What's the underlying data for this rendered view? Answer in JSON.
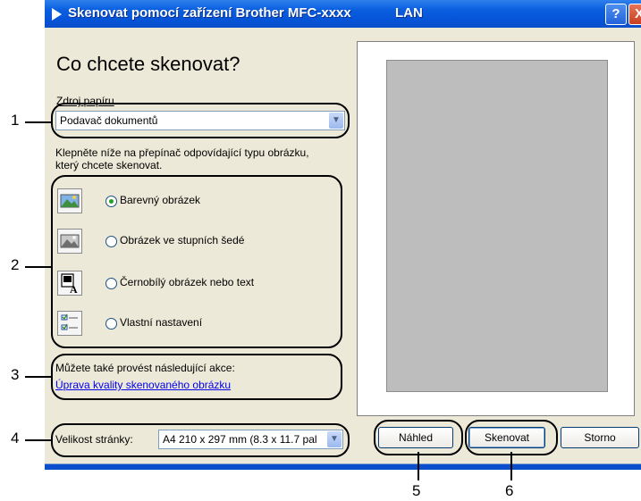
{
  "window": {
    "title": "Skenovat pomocí zařízení Brother MFC-xxxx",
    "title_suffix": "LAN",
    "help_label": "?",
    "close_label": "X"
  },
  "heading": "Co chcete skenovat?",
  "paper_source": {
    "label": "Zdroj papíru",
    "value": "Podavač dokumentů"
  },
  "instruction": {
    "line1": "Klepněte níže na přepínač odpovídající typu obrázku,",
    "line2": "který chcete skenovat."
  },
  "options": [
    {
      "label": "Barevný obrázek",
      "selected": true,
      "icon": "color-photo-icon"
    },
    {
      "label": "Obrázek ve stupních šedé",
      "selected": false,
      "icon": "grayscale-photo-icon"
    },
    {
      "label": "Černobílý obrázek nebo text",
      "selected": false,
      "icon": "bw-text-icon"
    },
    {
      "label": "Vlastní nastavení",
      "selected": false,
      "icon": "custom-settings-icon"
    }
  ],
  "extra_actions": {
    "text": "Můžete také provést následující akce:",
    "link": "Úprava kvality skenovaného obrázku"
  },
  "page_size": {
    "label": "Velikost stránky:",
    "value": "A4 210 x 297 mm (8.3 x 11.7 pal"
  },
  "buttons": {
    "preview": "Náhled",
    "scan": "Skenovat",
    "cancel": "Storno"
  },
  "callouts": [
    "1",
    "2",
    "3",
    "4",
    "5",
    "6"
  ],
  "colors": {
    "titlebar": "#0654d8",
    "dialog_bg": "#ece9d8",
    "preview_area": "#bdbdbd",
    "radio_selected": "#21a121"
  }
}
